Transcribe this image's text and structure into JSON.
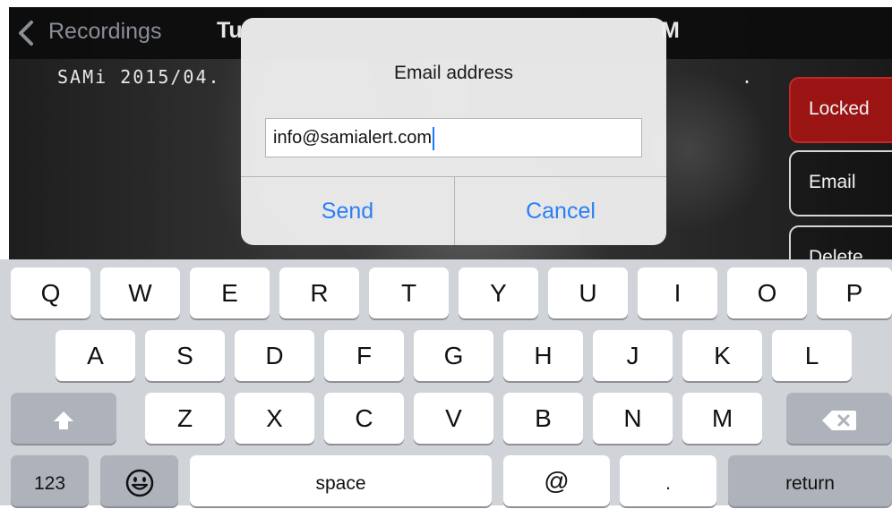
{
  "navbar": {
    "back_label": "Recordings",
    "title_left_fragment": "Tu",
    "title_right_fragment": "M"
  },
  "video": {
    "timestamp_overlay": "SAMi 2015/04.",
    "timestamp_overlay_right": "."
  },
  "side_buttons": {
    "locked": "Locked",
    "email": "Email",
    "delete": "Delete"
  },
  "alert": {
    "title": "Email address",
    "input_value": "info@samialert.com",
    "send_label": "Send",
    "cancel_label": "Cancel"
  },
  "keyboard": {
    "row1": [
      "Q",
      "W",
      "E",
      "R",
      "T",
      "Y",
      "U",
      "I",
      "O",
      "P"
    ],
    "row2": [
      "A",
      "S",
      "D",
      "F",
      "G",
      "H",
      "J",
      "K",
      "L"
    ],
    "row3": [
      "Z",
      "X",
      "C",
      "V",
      "B",
      "N",
      "M"
    ],
    "numbers_label": "123",
    "space_label": "space",
    "at_label": "@",
    "dot_label": ".",
    "return_label": "return",
    "shift_icon": "shift-icon",
    "delete_icon": "backspace-icon",
    "emoji_icon": "emoji-icon"
  },
  "colors": {
    "accent_blue": "#2a7ff6",
    "locked_red": "#9a1414",
    "keyboard_bg": "#d0d3d8",
    "key_dark": "#aeb3bb"
  }
}
